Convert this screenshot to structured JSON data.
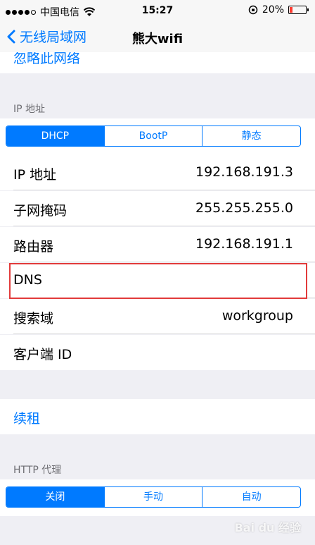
{
  "status_bar": {
    "carrier": "中国电信",
    "time": "15:27",
    "battery_percent": "20%",
    "battery_level": 0.2
  },
  "nav": {
    "back_label": "无线局域网",
    "title": "熊大wifi"
  },
  "top_cell": {
    "forget_label": "忽略此网络"
  },
  "ip_section": {
    "header": "IP 地址",
    "segments": [
      "DHCP",
      "BootP",
      "静态"
    ],
    "selected": "DHCP",
    "rows": [
      {
        "label": "IP 地址",
        "value": "192.168.191.3"
      },
      {
        "label": "子网掩码",
        "value": "255.255.255.0"
      },
      {
        "label": "路由器",
        "value": "192.168.191.1"
      },
      {
        "label": "DNS",
        "value": ""
      },
      {
        "label": "搜索域",
        "value": "workgroup"
      },
      {
        "label": "客户端 ID",
        "value": ""
      }
    ]
  },
  "renew": {
    "label": "续租"
  },
  "proxy_section": {
    "header": "HTTP 代理",
    "segments": [
      "关闭",
      "手动",
      "自动"
    ],
    "selected": "关闭"
  },
  "watermark": "Bai du 经验",
  "colors": {
    "accent": "#007aff",
    "background": "#efeff4",
    "highlight": "#e23b3b"
  }
}
